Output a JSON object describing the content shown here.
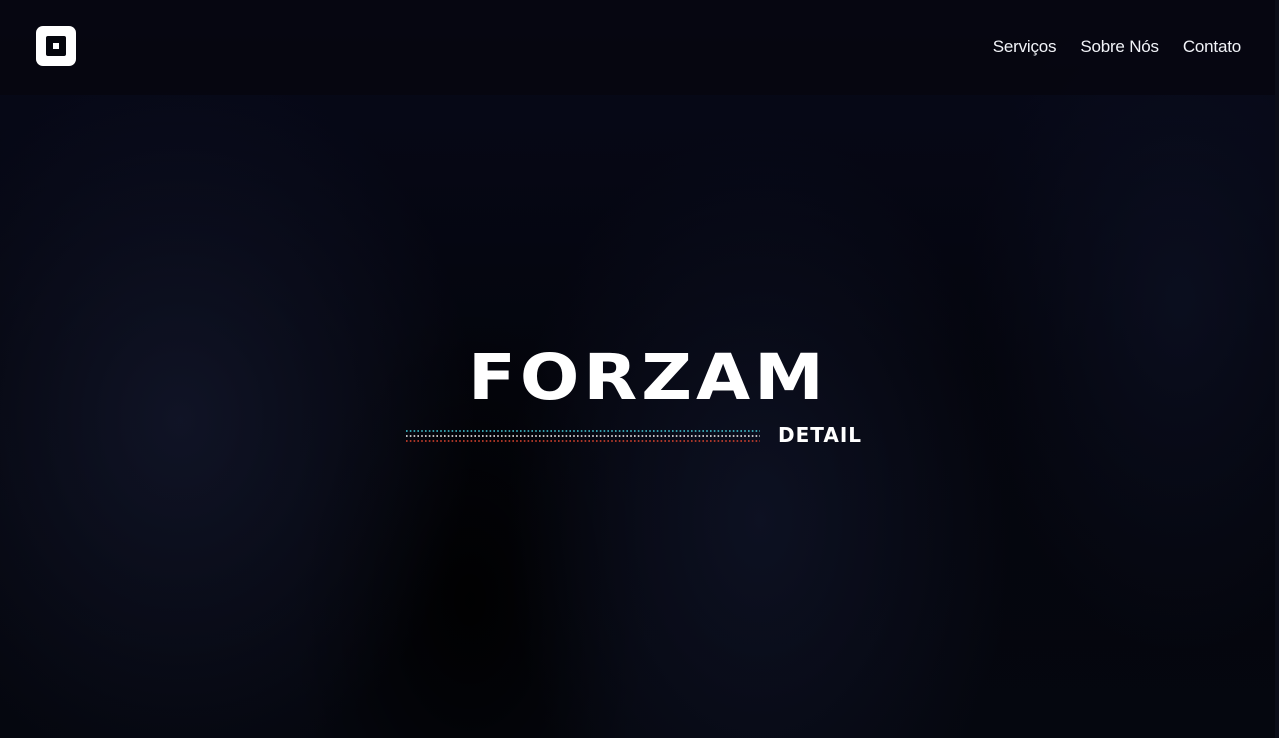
{
  "header": {
    "logo_icon": "square-logo-icon",
    "nav": [
      {
        "label": "Serviços"
      },
      {
        "label": "Sobre Nós"
      },
      {
        "label": "Contato"
      }
    ]
  },
  "hero": {
    "brand": "FORZAM",
    "tagline": "DETAIL",
    "stripe_colors": [
      "#3fd0e0",
      "#ffffff",
      "#e0442e"
    ]
  }
}
